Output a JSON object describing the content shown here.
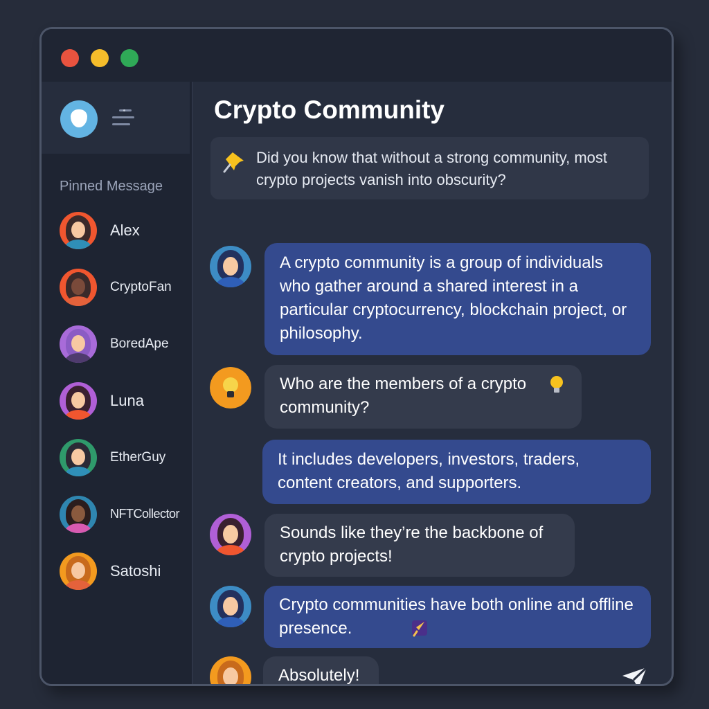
{
  "window": {
    "controls": [
      "close",
      "minimize",
      "maximize"
    ]
  },
  "sidebar": {
    "pinned_label": "Pinned Message",
    "users": [
      {
        "name": "Alex",
        "bg": "#f0562f",
        "hair": "#3b2a2a",
        "body": "#2f8fb8"
      },
      {
        "name": "CryptoFan",
        "bg": "#f0562f",
        "hair": "#3a2a2a",
        "body": "#e4623b"
      },
      {
        "name": "BoredApe",
        "bg": "#a86bd9",
        "hair": "#8b5cc4",
        "body": "#4f3b6e"
      },
      {
        "name": "Luna",
        "bg": "#b05fd6",
        "hair": "#3a2030",
        "body": "#f0562f"
      },
      {
        "name": "EtherGuy",
        "bg": "#2f9a6b",
        "hair": "#2b2a35",
        "body": "#2f8fb8"
      },
      {
        "name": "NFTCollector",
        "bg": "#2f86b0",
        "hair": "#2b1d1d",
        "body": "#d85ab0"
      },
      {
        "name": "Satoshi",
        "bg": "#f39a1f",
        "hair": "#c86a1c",
        "body": "#e4623b"
      }
    ]
  },
  "chat": {
    "title": "Crypto Community",
    "pinned_message": "Did you know that without a strong community, most crypto projects vanish into obscurity?",
    "messages": [
      {
        "text": "A crypto community is a group of individuals who gather around a shared interest in a particular cryptocurrency, blockchain project, or philosophy.",
        "style": "blue",
        "avatar": "blue-user"
      },
      {
        "text": "Who are the members of a crypto community?",
        "style": "gray",
        "avatar": "lightbulb"
      },
      {
        "text": "It includes developers, investors, traders, content creators, and supporters.",
        "style": "blue"
      },
      {
        "text": "Sounds like they’re the backbone of crypto projects!",
        "style": "gray",
        "avatar": "purple-user"
      },
      {
        "text": "Crypto communities have both online and offline presence.",
        "style": "blue",
        "avatar": "blue-user"
      },
      {
        "text": "Absolutely!",
        "style": "gray",
        "avatar": "orange-user"
      }
    ]
  },
  "icons": {
    "app_logo": "app-logo-icon",
    "menu": "menu-lines-icon",
    "pin": "pushpin-icon",
    "bulb": "lightbulb-icon",
    "rocket": "rocket-icon",
    "send": "send-icon"
  },
  "colors": {
    "background": "#262c3a",
    "sidebar": "#1e2432",
    "bubble_blue": "#344a8e",
    "bubble_gray": "#343b4c",
    "accent_yellow": "#f7c21e"
  }
}
